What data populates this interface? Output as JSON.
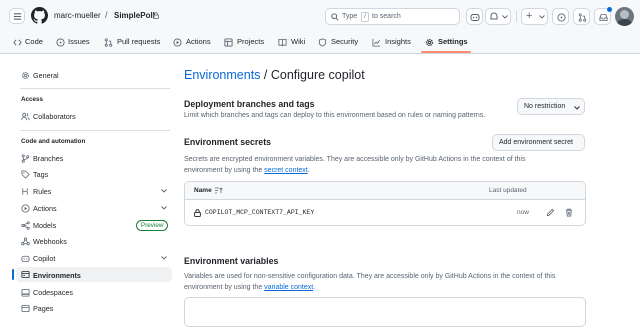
{
  "header": {
    "owner": "marc-mueller",
    "separator": "/",
    "repo": "SimplePoll",
    "search_placeholder": "Type / to search",
    "search_prefix": "Type",
    "search_key": "/",
    "search_suffix": "to search",
    "plus_label": "+"
  },
  "repo_nav": [
    {
      "label": "Code",
      "icon": "code-icon"
    },
    {
      "label": "Issues",
      "icon": "issue-icon"
    },
    {
      "label": "Pull requests",
      "icon": "pull-request-icon"
    },
    {
      "label": "Actions",
      "icon": "play-icon"
    },
    {
      "label": "Projects",
      "icon": "table-icon"
    },
    {
      "label": "Wiki",
      "icon": "book-icon"
    },
    {
      "label": "Security",
      "icon": "shield-icon"
    },
    {
      "label": "Insights",
      "icon": "graph-icon"
    },
    {
      "label": "Settings",
      "icon": "gear-icon",
      "selected": true
    }
  ],
  "sidebar": {
    "general": "General",
    "access_heading": "Access",
    "collaborators": "Collaborators",
    "code_heading": "Code and automation",
    "items": [
      {
        "label": "Branches"
      },
      {
        "label": "Tags"
      },
      {
        "label": "Rules",
        "expandable": true
      },
      {
        "label": "Actions",
        "expandable": true
      },
      {
        "label": "Models",
        "badge": "Preview"
      },
      {
        "label": "Webhooks"
      },
      {
        "label": "Copilot",
        "expandable": true
      },
      {
        "label": "Environments",
        "selected": true
      },
      {
        "label": "Codespaces"
      },
      {
        "label": "Pages"
      }
    ]
  },
  "main": {
    "breadcrumb_link": "Environments",
    "breadcrumb_rest": "/ Configure copilot",
    "deploy": {
      "title": "Deployment branches and tags",
      "desc": "Limit which branches and tags can deploy to this environment based on rules or naming patterns.",
      "select": "No restriction"
    },
    "secrets": {
      "title": "Environment secrets",
      "add_button": "Add environment secret",
      "desc_1": "Secrets are encrypted environment variables. They are accessible only by GitHub Actions in the context of this",
      "desc_2": "environment by using the",
      "link": "secret context",
      "period": ".",
      "col_name": "Name",
      "col_updated": "Last updated",
      "rows": [
        {
          "name": "COPILOT_MCP_CONTEXT7_API_KEY",
          "updated": "now"
        }
      ]
    },
    "variables": {
      "title": "Environment variables",
      "desc_1": "Variables are used for non-sensitive configuration data. They are accessible only by GitHub Actions in the context of this",
      "desc_2": "environment by using the",
      "link": "variable context",
      "period": "."
    }
  },
  "colors": {
    "accent": "#0969da",
    "selected_underline": "#fd8c73",
    "preview_badge": "#1a7f37"
  }
}
